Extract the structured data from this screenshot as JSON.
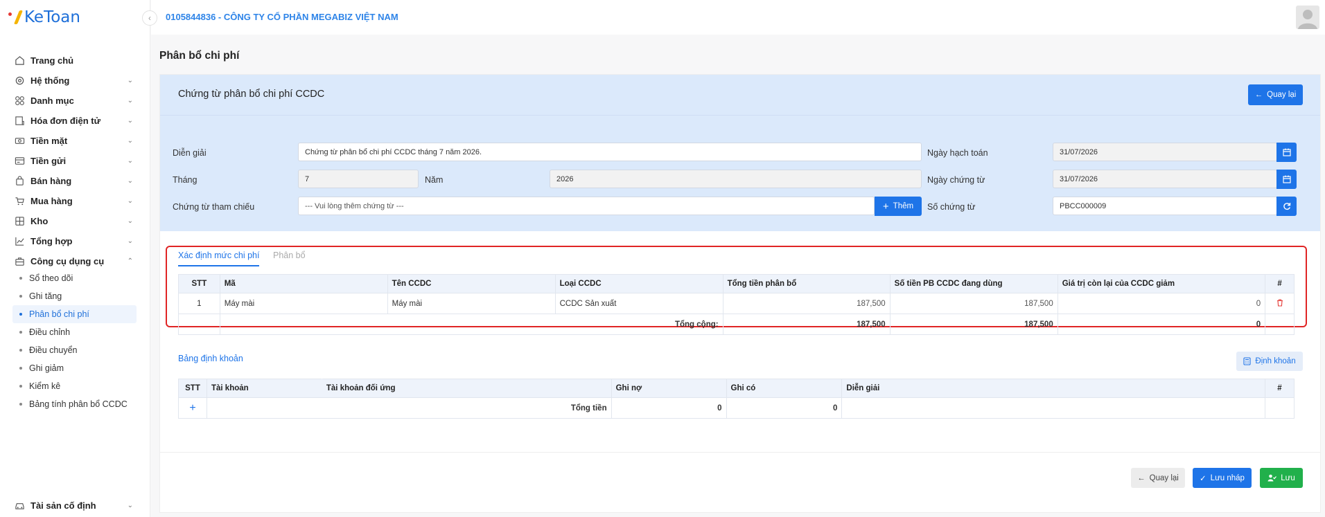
{
  "brand": {
    "name": "KeToan"
  },
  "topbar": {
    "company": "0105844836 - CÔNG TY CỔ PHẦN MEGABIZ VIỆT NAM"
  },
  "sidebar": {
    "items": [
      {
        "label": "Trang chủ",
        "icon": "home-icon",
        "chevron": false
      },
      {
        "label": "Hệ thống",
        "icon": "gear-icon",
        "chevron": true
      },
      {
        "label": "Danh mục",
        "icon": "grid-icon",
        "chevron": true
      },
      {
        "label": "Hóa đơn điện tử",
        "icon": "invoice-icon",
        "chevron": true
      },
      {
        "label": "Tiền mặt",
        "icon": "cash-icon",
        "chevron": true
      },
      {
        "label": "Tiền gửi",
        "icon": "bank-icon",
        "chevron": true
      },
      {
        "label": "Bán hàng",
        "icon": "bag-icon",
        "chevron": true
      },
      {
        "label": "Mua hàng",
        "icon": "cart-icon",
        "chevron": true
      },
      {
        "label": "Kho",
        "icon": "warehouse-icon",
        "chevron": true
      },
      {
        "label": "Tổng hợp",
        "icon": "chart-icon",
        "chevron": true
      },
      {
        "label": "Công cụ dụng cụ",
        "icon": "tools-icon",
        "chevron": true,
        "expanded": true
      }
    ],
    "subitems": [
      {
        "label": "Sổ theo dõi"
      },
      {
        "label": "Ghi tăng"
      },
      {
        "label": "Phân bổ chi phí",
        "active": true
      },
      {
        "label": "Điều chỉnh"
      },
      {
        "label": "Điều chuyển"
      },
      {
        "label": "Ghi giảm"
      },
      {
        "label": "Kiểm kê"
      },
      {
        "label": "Bảng tính phân bổ CCDC"
      }
    ],
    "last_item": {
      "label": "Tài sản cố định",
      "icon": "car-icon"
    }
  },
  "page": {
    "title": "Phân bổ chi phí"
  },
  "card": {
    "title": "Chứng từ phân bổ chi phí CCDC",
    "back_label": "Quay lại"
  },
  "form": {
    "dien_giai_label": "Diễn giải",
    "dien_giai_value": "Chứng từ phân bổ chi phí CCDC tháng 7 năm 2026.",
    "thang_label": "Tháng",
    "thang_value": "7",
    "nam_label": "Năm",
    "nam_value": "2026",
    "tham_chieu_label": "Chứng từ tham chiếu",
    "tham_chieu_placeholder": "--- Vui lòng thêm chứng từ ---",
    "them_label": "Thêm",
    "ngay_hach_toan_label": "Ngày hạch toán",
    "ngay_hach_toan_value": "31/07/2026",
    "ngay_chung_tu_label": "Ngày chứng từ",
    "ngay_chung_tu_value": "31/07/2026",
    "so_chung_tu_label": "Số chứng từ",
    "so_chung_tu_value": "PBCC000009"
  },
  "tabs": [
    {
      "label": "Xác định mức chi phí",
      "active": true
    },
    {
      "label": "Phân bổ",
      "active": false
    }
  ],
  "cost_table": {
    "headers": [
      "STT",
      "Mã",
      "Tên CCDC",
      "Loại CCDC",
      "Tổng tiền phân bổ",
      "Số tiền PB CCDC đang dùng",
      "Giá trị còn lại của CCDC giảm",
      "#"
    ],
    "rows": [
      {
        "stt": "1",
        "ma": "Máy mài",
        "ten": "Máy mài",
        "loai": "CCDC Sản xuất",
        "tong": "187,500",
        "dang_dung": "187,500",
        "con_lai": "0"
      }
    ],
    "total_label": "Tổng cộng:",
    "total_tong": "187,500",
    "total_dang_dung": "187,500",
    "total_con_lai": "0"
  },
  "accounting": {
    "title": "Bảng định khoản",
    "button_label": "Định khoản",
    "headers": [
      "STT",
      "Tài khoản",
      "Tài khoản đối ứng",
      "Ghi nợ",
      "Ghi có",
      "Diễn giải",
      "#"
    ],
    "total_label": "Tổng tiền",
    "total_no": "0",
    "total_co": "0"
  },
  "footer": {
    "back_label": "Quay lại",
    "draft_label": "Lưu nháp",
    "save_label": "Lưu"
  }
}
